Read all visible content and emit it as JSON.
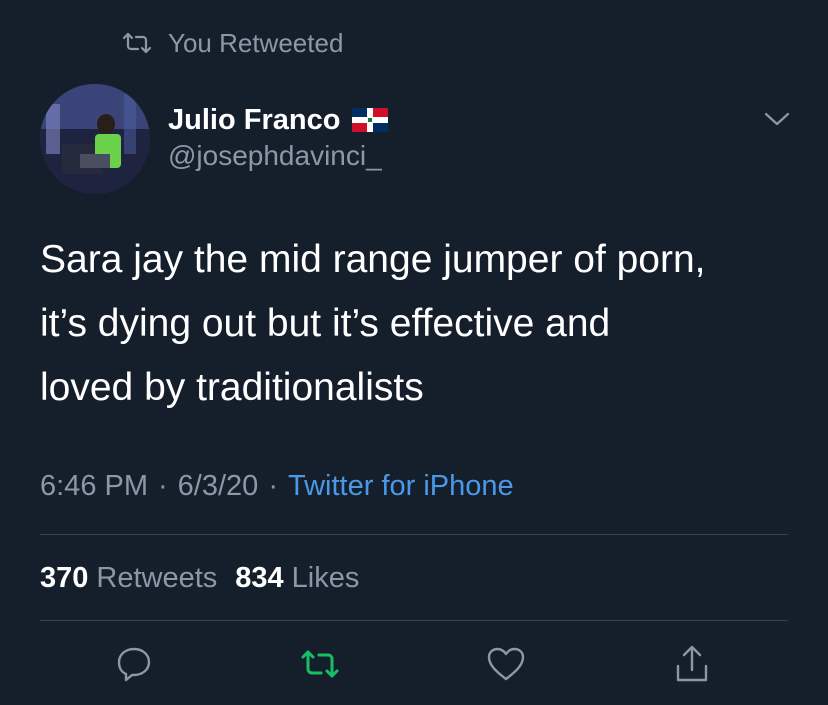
{
  "retweet_banner": {
    "icon": "retweet-icon",
    "text": "You Retweeted"
  },
  "author": {
    "name": "Julio Franco",
    "flag": "dominican-republic-flag",
    "handle": "@josephdavinci_"
  },
  "tweet": {
    "text": "Sara jay the mid range jumper of porn,\nit’s dying out but it’s effective and\nloved by traditionalists",
    "time": "6:46 PM",
    "date": "6/3/20",
    "separator": "·",
    "source": "Twitter for iPhone"
  },
  "stats": {
    "retweets_count": "370",
    "retweets_label": "Retweets",
    "likes_count": "834",
    "likes_label": "Likes"
  },
  "actions": {
    "reply_icon": "reply-icon",
    "retweet_icon": "retweet-icon",
    "like_icon": "heart-icon",
    "share_icon": "share-icon"
  },
  "colors": {
    "background": "#151f2b",
    "muted_text": "#8b98a5",
    "link": "#4a99e9",
    "retweeted_green": "#17bf63",
    "divider": "#38444d"
  }
}
